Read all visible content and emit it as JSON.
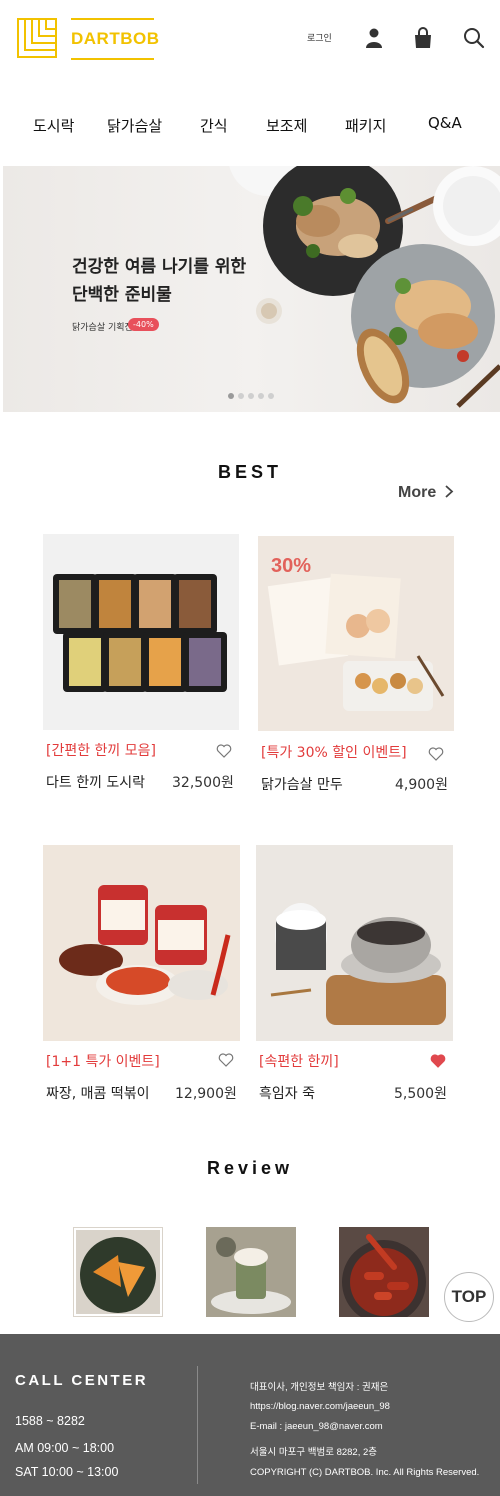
{
  "header": {
    "brand": "DARTBOB",
    "login_label": "로그인",
    "icons": [
      "user-icon",
      "cart-icon",
      "search-icon"
    ]
  },
  "nav": {
    "items": [
      "도시락",
      "닭가슴살",
      "간식",
      "보조제",
      "패키지",
      "Q&A"
    ]
  },
  "banner": {
    "line1": "건강한 여름 나기를 위한",
    "line2": "단백한 준비물",
    "sub": "닭가슴살 기획전",
    "badge": "-40%",
    "slide_count": 5,
    "active_slide": 1
  },
  "best": {
    "title": "BEST",
    "more_label": "More",
    "products": [
      {
        "tag": "[간편한 한끼 모음]",
        "name": "다트 한끼 도시락",
        "price": "32,500원",
        "liked": false
      },
      {
        "tag": "[특가 30% 할인 이벤트]",
        "name": "닭가슴살 만두",
        "price": "4,900원",
        "liked": false,
        "image_badge": "30%"
      },
      {
        "tag": "[1+1 특가 이벤트]",
        "name": "짜장, 매콤 떡볶이",
        "price": "12,900원",
        "liked": false
      },
      {
        "tag": "[속편한 한끼]",
        "name": "흑임자 죽",
        "price": "5,500원",
        "liked": true
      }
    ]
  },
  "review": {
    "title": "Review",
    "top_label": "TOP"
  },
  "footer": {
    "cc_title": "CALL CENTER",
    "phone": "1588 ~ 8282",
    "hours1": "AM 09:00 ~ 18:00",
    "hours2": "SAT 10:00 ~ 13:00",
    "info": [
      "대표이사, 개인정보 책임자 : 권재은",
      "https://blog.naver.com/jaeeun_98",
      "E-mail : jaeeun_98@naver.com",
      "서울시 마포구 백범로 8282, 2층",
      "COPYRIGHT (C) DARTBOB. Inc. All Rights Reserved."
    ]
  },
  "colors": {
    "brand_yellow": "#f2c200",
    "tag_red": "#e23b3b",
    "footer_bg": "#5a5a5a",
    "heart_filled": "#e0484e"
  }
}
